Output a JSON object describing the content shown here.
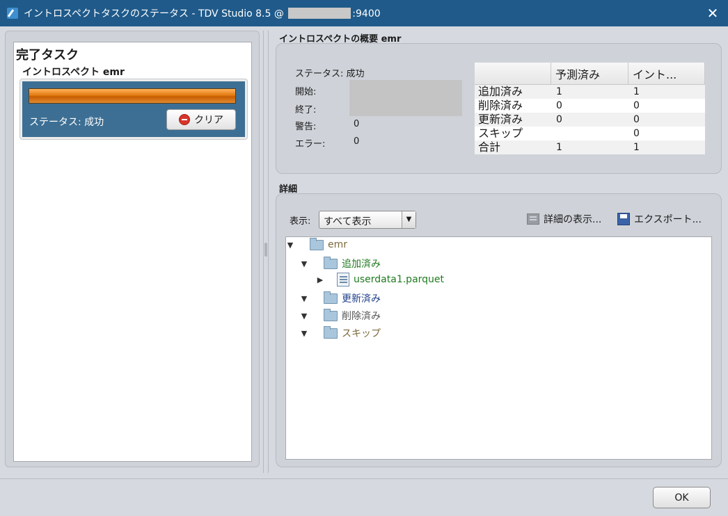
{
  "window": {
    "title_prefix": "イントロスペクトタスクのステータス - TDV Studio 8.5 @ ",
    "title_suffix": ":9400",
    "close_glyph": "✕"
  },
  "left": {
    "heading": "完了タスク",
    "task_name": "イントロスペクト emr",
    "progress_percent": 100,
    "status": "ステータス: 成功",
    "clear_label": "クリア"
  },
  "summary": {
    "heading": "イントロスペクトの概要 emr",
    "status": "ステータス: 成功",
    "start_label": "開始:",
    "end_label": "終了:",
    "warnings_label": "警告:",
    "warnings_value": "0",
    "errors_label": "エラー:",
    "errors_value": "0",
    "table": {
      "headers": [
        "",
        "予測済み",
        "イント..."
      ],
      "rows": [
        [
          "追加済み",
          "1",
          "1"
        ],
        [
          "削除済み",
          "0",
          "0"
        ],
        [
          "更新済み",
          "0",
          "0"
        ],
        [
          "スキップ",
          "",
          "0"
        ],
        [
          "合計",
          "1",
          "1"
        ]
      ]
    }
  },
  "details": {
    "heading": "詳細",
    "show_label": "表示:",
    "show_value": "すべて表示",
    "detail_button": "詳細の表示...",
    "export_button": "エクスポート...",
    "tree": [
      {
        "label": "emr",
        "color": "#7a6a3a"
      },
      {
        "label": "追加済み",
        "color": "#1f7a1f"
      },
      {
        "label": "userdata1.parquet",
        "color": "#1f7a1f"
      },
      {
        "label": "更新済み",
        "color": "#1f3f8a"
      },
      {
        "label": "削除済み",
        "color": "#555555"
      },
      {
        "label": "スキップ",
        "color": "#7a6a3a"
      }
    ]
  },
  "footer": {
    "ok_label": "OK"
  }
}
